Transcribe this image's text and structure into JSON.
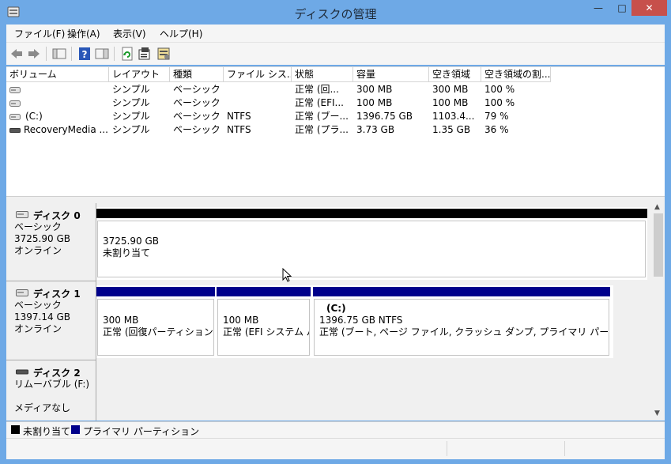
{
  "window": {
    "title": "ディスクの管理",
    "minimize": "—",
    "maximize": "□",
    "close": "✕"
  },
  "menu": [
    "ファイル(F)",
    "操作(A)",
    "表示(V)",
    "ヘルプ(H)"
  ],
  "toolbar": [
    "back-icon",
    "forward-icon",
    "show-hide-console-tree-icon",
    "help-icon",
    "show-hide-action-pane-icon",
    "refresh-icon",
    "properties-icon",
    "disk-settings-icon"
  ],
  "volume_list": {
    "columns": [
      "ボリューム",
      "レイアウト",
      "種類",
      "ファイル シス...",
      "状態",
      "容量",
      "空き領域",
      "空き領域の割..."
    ],
    "rows": [
      [
        "",
        "シンプル",
        "ベーシック",
        "",
        "正常 (回...",
        "300 MB",
        "300 MB",
        "100 %"
      ],
      [
        "",
        "シンプル",
        "ベーシック",
        "",
        "正常 (EFI...",
        "100 MB",
        "100 MB",
        "100 %"
      ],
      [
        "(C:)",
        "シンプル",
        "ベーシック",
        "NTFS",
        "正常 (ブー...",
        "1396.75 GB",
        "1103.4...",
        "79 %"
      ],
      [
        "RecoveryMedia ...",
        "シンプル",
        "ベーシック",
        "NTFS",
        "正常 (プラ...",
        "3.73 GB",
        "1.35 GB",
        "36 %"
      ]
    ]
  },
  "disks": [
    {
      "name": "ディスク 0",
      "type": "ベーシック",
      "size": "3725.90 GB",
      "status": "オンライン",
      "partitions": [
        {
          "title": "",
          "line1": "3725.90 GB",
          "line2": "未割り当て",
          "color": "#000000"
        }
      ]
    },
    {
      "name": "ディスク 1",
      "type": "ベーシック",
      "size": "1397.14 GB",
      "status": "オンライン",
      "partitions": [
        {
          "title": "",
          "line1": "300 MB",
          "line2": "正常 (回復パーティション)",
          "color": "#00008b"
        },
        {
          "title": "",
          "line1": "100 MB",
          "line2": "正常 (EFI システム パ",
          "color": "#00008b"
        },
        {
          "title": "(C:)",
          "line1": "1396.75 GB NTFS",
          "line2": "正常 (ブート, ページ ファイル, クラッシュ ダンプ, プライマリ パーティション)",
          "color": "#00008b"
        }
      ]
    },
    {
      "name": "ディスク 2",
      "type": "リムーバブル (F:)",
      "size": "",
      "status": "メディアなし",
      "partitions": []
    }
  ],
  "legend": [
    {
      "label": "未割り当て",
      "color": "#000000"
    },
    {
      "label": "プライマリ パーティション",
      "color": "#00008b"
    }
  ]
}
